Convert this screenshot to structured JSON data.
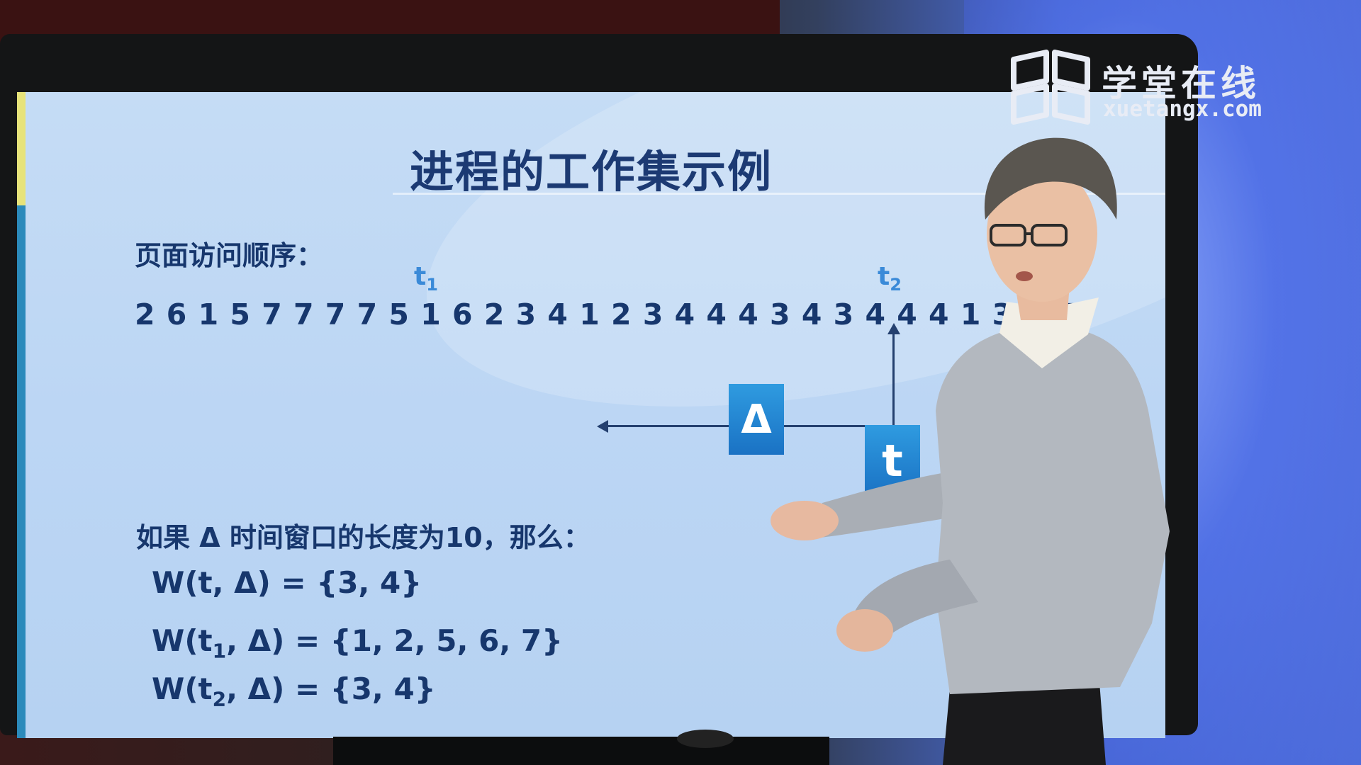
{
  "logo": {
    "name": "学堂在线",
    "url": "xuetangx.com"
  },
  "slide": {
    "title": "进程的工作集示例",
    "sequence_label": "页面访问顺序：",
    "sequence": "2 6 1 5 7 7 7 7 5 1 6 2 3 4 1 2 3 4 4 4 3 4 3 4 4 4 1 3 2 7",
    "marker_t1": {
      "base": "t",
      "sub": "1"
    },
    "marker_t2": {
      "base": "t",
      "sub": "2"
    },
    "delta_box": "Δ",
    "t_box": "t",
    "condition": "如果 Δ 时间窗口的长度为10，那么：",
    "formula_w_t": {
      "prefix": "W(t, Δ)  =  ",
      "set": "{3, 4}"
    },
    "formula_w_t1": {
      "prefix": "W(t",
      "sub": "1",
      "suffix": ", Δ) = {1, 2, 5, 6, 7}"
    },
    "formula_w_t2": {
      "prefix": "W(t",
      "sub": "2",
      "suffix": ", Δ) = {3, 4}"
    }
  },
  "colors": {
    "title": "#1c3a73",
    "text": "#17376d",
    "marker": "#3a8ad8",
    "box": "#1f86d4",
    "screen": "#c0d9f4"
  }
}
